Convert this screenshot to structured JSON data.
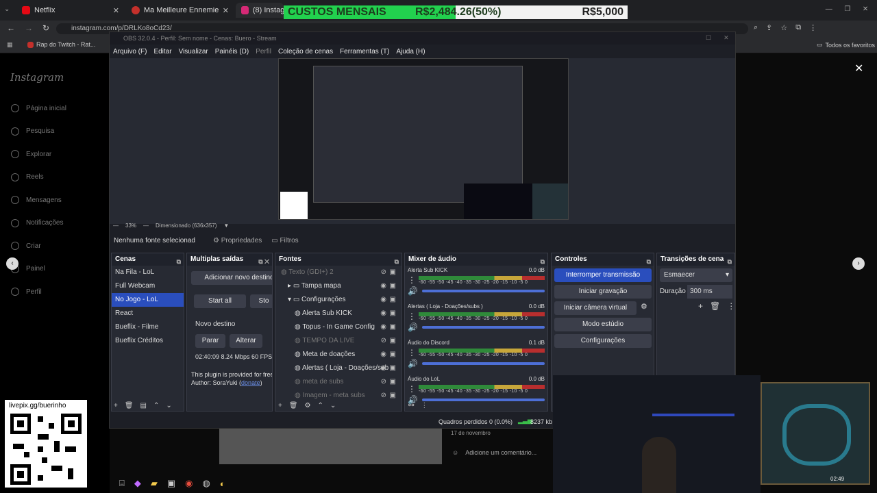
{
  "browser": {
    "tabs": [
      {
        "label": "Netflix",
        "color": "#e50914"
      },
      {
        "label": "Ma Meilleure Ennemie (part. Pa",
        "color": "#c4302b"
      },
      {
        "label": "(8) Instagram",
        "color": "#d62976"
      }
    ],
    "url": "instagram.com/p/DRLKo8oCd23/",
    "bookmarks": [
      "Rap do Twitch - Rat...",
      "Todos os favoritos"
    ]
  },
  "overlay": {
    "label": "CUSTOS MENSAIS",
    "current": "R$2,484.26(50%)",
    "goal": "R$5,000",
    "progress": 0.5
  },
  "instagram": {
    "logo": "Instagram",
    "nav": [
      "Página inicial",
      "Pesquisa",
      "Explorar",
      "Reels",
      "Mensagens",
      "Notificações",
      "Criar",
      "Painel",
      "Perfil"
    ],
    "date": "17 de novembro",
    "comment_placeholder": "Adicione um comentário..."
  },
  "obs": {
    "title": "OBS 32.0.4 - Perfil: Sem nome - Cenas: Buero - Stream",
    "menu": [
      "Arquivo (F)",
      "Editar",
      "Visualizar",
      "Painéis (D)",
      "Perfil",
      "Coleção de cenas",
      "Ferramentas (T)",
      "Ajuda (H)"
    ],
    "zoom": "33%",
    "scale_mode": "Dimensionado (636x357)",
    "no_source": "Nenhuma fonte selecionad",
    "properties": "Propriedades",
    "filters": "Filtros",
    "scenes": {
      "title": "Cenas",
      "items": [
        "Na Fila - LoL",
        "Full Webcam",
        "No Jogo - LoL",
        "React",
        "Bueflix - Filme",
        "Bueflix Créditos"
      ],
      "selected": 2
    },
    "outputs": {
      "title": "Multiplas saídas",
      "add": "Adicionar novo destino",
      "start": "Start all",
      "stop": "Sto",
      "new_dest": "Novo destino",
      "stop_btn": "Parar",
      "change": "Alterar",
      "stats": "02:40:09  8.24 Mbps  60 FPS",
      "plugin": "This plugin is provided for free",
      "author": "Author: SoraYuki (",
      "donate": "donate",
      ")": ")"
    },
    "sources": {
      "title": "Fontes",
      "items": [
        {
          "label": "Texto (GDI+) 2",
          "dim": true,
          "indent": 0
        },
        {
          "label": "Tampa mapa",
          "dim": false,
          "indent": 1,
          "folder": true
        },
        {
          "label": "Configurações",
          "dim": false,
          "indent": 1,
          "folder": true
        },
        {
          "label": "Alerta Sub KICK",
          "dim": false,
          "indent": 2
        },
        {
          "label": "Topus - In Game Config",
          "dim": false,
          "indent": 2
        },
        {
          "label": "TEMPO DA LIVE",
          "dim": true,
          "indent": 2
        },
        {
          "label": "Meta de doações",
          "dim": false,
          "indent": 2
        },
        {
          "label": "Alertas ( Loja - Doações/sub",
          "dim": false,
          "indent": 2
        },
        {
          "label": "meta de subs",
          "dim": true,
          "indent": 2
        },
        {
          "label": "Imagem - meta subs",
          "dim": true,
          "indent": 2
        }
      ]
    },
    "mixer": {
      "title": "Mixer de áudio",
      "scale": "-60 -55 -50 -45 -40 -35 -30 -25 -20 -15 -10 -5 0",
      "channels": [
        {
          "name": "Alerta Sub KICK",
          "db": "0.0 dB"
        },
        {
          "name": "Alertas ( Loja - Doações/subs )",
          "db": "0.0 dB"
        },
        {
          "name": "Áudio do Discord",
          "db": "0.1 dB"
        },
        {
          "name": "Áudio do LoL",
          "db": "0.0 dB"
        }
      ]
    },
    "controls": {
      "title": "Controles",
      "buttons": [
        "Interromper transmissão",
        "Iniciar gravação",
        "Iniciar câmera virtual",
        "Modo estúdio",
        "Configurações"
      ]
    },
    "transitions": {
      "title": "Transições de cena",
      "selected": "Esmaecer",
      "duration_label": "Duração",
      "duration": "300 ms"
    },
    "status": {
      "dropped": "Quadros perdidos 0 (0.0%)",
      "bitrate": "8237 kb"
    }
  },
  "qr": {
    "label": "livepix.gg/buerinho"
  },
  "minimap_time": "02:49"
}
